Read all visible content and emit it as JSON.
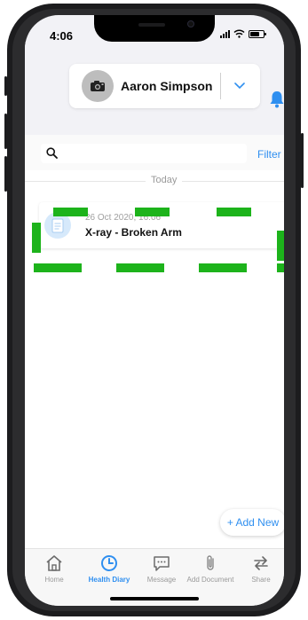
{
  "status_bar": {
    "time": "4:06"
  },
  "profile": {
    "name": "Aaron Simpson"
  },
  "search": {
    "placeholder": "",
    "filter_label": "Filter"
  },
  "list": {
    "section_label": "Today",
    "entries": [
      {
        "date": "26 Oct 2020, 16:06",
        "title": "X-ray - Broken Arm"
      }
    ]
  },
  "add_new_label": "+ Add New",
  "tabs": [
    {
      "label": "Home",
      "icon": "home-icon"
    },
    {
      "label": "Health Diary",
      "icon": "clock-icon",
      "active": true
    },
    {
      "label": "Message",
      "icon": "message-icon"
    },
    {
      "label": "Add Document",
      "icon": "paperclip-icon"
    },
    {
      "label": "Share",
      "icon": "share-arrows-icon"
    }
  ],
  "colors": {
    "accent": "#2f8ff0",
    "highlight_dash": "#1db31b"
  }
}
